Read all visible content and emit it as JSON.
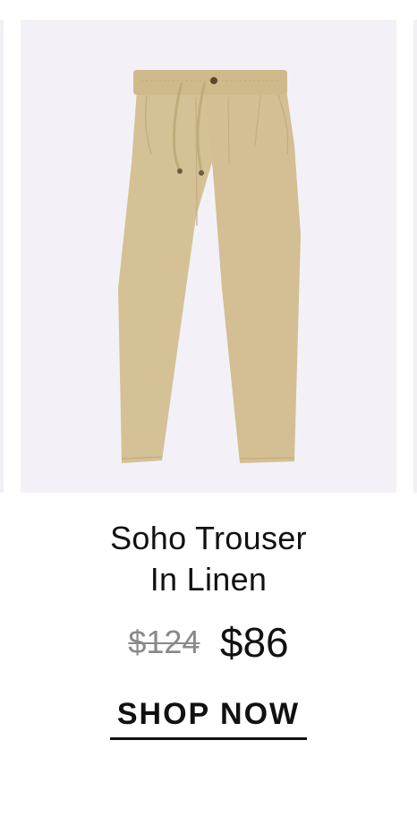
{
  "product": {
    "title_line1": "Soho Trouser",
    "title_line2": "In Linen",
    "original_price": "$124",
    "sale_price": "$86",
    "cta_label": "SHOP NOW",
    "image_alt": "Khaki drawstring trousers"
  },
  "colors": {
    "card_background": "#f3f1f7",
    "fabric": "#d5c196",
    "text": "#111111",
    "strike_price": "#8a8a8a"
  }
}
